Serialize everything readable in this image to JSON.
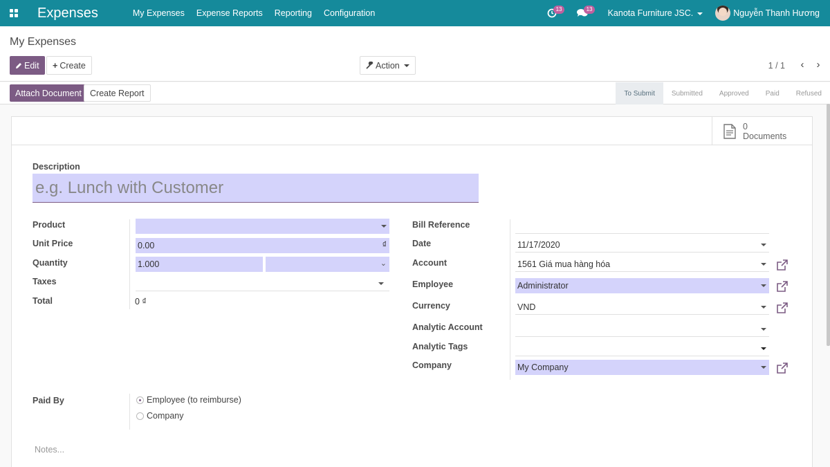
{
  "nav": {
    "brand": "Expenses",
    "menu": [
      "My Expenses",
      "Expense Reports",
      "Reporting",
      "Configuration"
    ],
    "activity_count": "13",
    "messages_count": "13",
    "company": "Kanota Furniture JSC.",
    "user": "Nguyễn Thanh Hương"
  },
  "control": {
    "title": "My Expenses",
    "edit": "Edit",
    "create": "Create",
    "action": "Action",
    "pager": "1 / 1"
  },
  "statusbar": {
    "attach": "Attach Document",
    "create_report": "Create Report",
    "stages": [
      "To Submit",
      "Submitted",
      "Approved",
      "Paid",
      "Refused"
    ],
    "active_stage": "To Submit"
  },
  "form": {
    "documents_count": "0",
    "documents_label": "Documents",
    "description_label": "Description",
    "description_placeholder": "e.g. Lunch with Customer",
    "left": {
      "product_label": "Product",
      "product_value": "",
      "unit_price_label": "Unit Price",
      "unit_price_value": "0.00",
      "currency_symbol": "₫",
      "quantity_label": "Quantity",
      "quantity_value": "1.000",
      "uom_value": "",
      "taxes_label": "Taxes",
      "total_label": "Total",
      "total_value": "0 ₫"
    },
    "right": {
      "bill_reference_label": "Bill Reference",
      "bill_reference_value": "",
      "date_label": "Date",
      "date_value": "11/17/2020",
      "account_label": "Account",
      "account_value": "1561 Giá mua hàng hóa",
      "employee_label": "Employee",
      "employee_value": "Administrator",
      "currency_label": "Currency",
      "currency_value": "VND",
      "analytic_account_label": "Analytic Account",
      "analytic_tags_label": "Analytic Tags",
      "company_label": "Company",
      "company_value": "My Company"
    },
    "paid_by_label": "Paid By",
    "paid_by_options": [
      "Employee (to reimburse)",
      "Company"
    ],
    "paid_by_selected": "Employee (to reimburse)",
    "notes_placeholder": "Notes..."
  },
  "colors": {
    "topbar": "#158a9b",
    "primary": "#7c5b84",
    "required_field": "#d4d3fb"
  }
}
